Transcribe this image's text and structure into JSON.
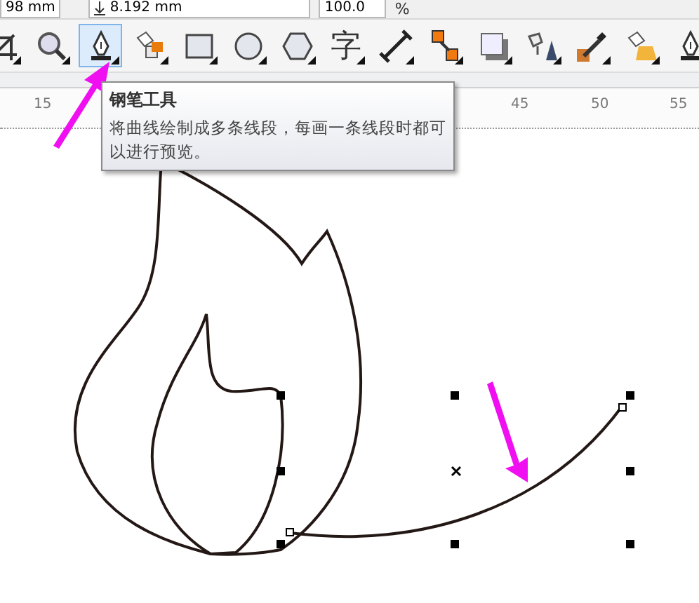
{
  "property_bar": {
    "fields": [
      {
        "value": "98 mm",
        "kind": "plain"
      },
      {
        "value": "8.192 mm",
        "kind": "height"
      },
      {
        "value": "100.0",
        "kind": "plain"
      }
    ],
    "unit": "%"
  },
  "toolbar": {
    "tools": [
      {
        "kind": "crop",
        "selected": false
      },
      {
        "kind": "zoom",
        "selected": false
      },
      {
        "kind": "pen",
        "selected": true
      },
      {
        "kind": "smart-fill",
        "selected": false
      },
      {
        "kind": "rectangle",
        "selected": false
      },
      {
        "kind": "ellipse",
        "selected": false
      },
      {
        "kind": "polygon",
        "selected": false
      },
      {
        "kind": "text",
        "label": "字",
        "selected": false
      },
      {
        "kind": "dimension",
        "selected": false
      },
      {
        "kind": "connector",
        "selected": false
      },
      {
        "kind": "shadow",
        "selected": false
      },
      {
        "kind": "transparency",
        "selected": false
      },
      {
        "kind": "eyedropper",
        "selected": false
      },
      {
        "kind": "interactive-fill",
        "selected": false
      },
      {
        "kind": "pen",
        "selected": false
      }
    ]
  },
  "ruler": {
    "labels": [
      "15",
      "45",
      "50",
      "55"
    ]
  },
  "tooltip": {
    "title": "钢笔工具",
    "text": "将曲线绘制成多条线段，每画一条线段时都可以进行预览。"
  }
}
